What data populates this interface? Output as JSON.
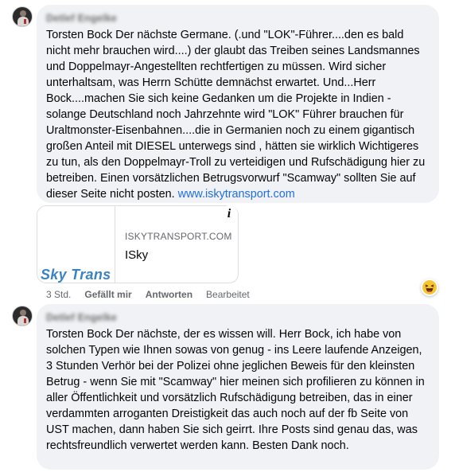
{
  "comments": [
    {
      "author": "Detlef Engelke",
      "text": "Torsten Bock Der nächste Germane. (.und \"LOK\"-Führer....den es bald nicht mehr brauchen wird....) der glaubt das Treiben seines Landsmannes und Doppelmayr-Angestellten rechtfertigen zu müssen. Wird sicher unterhaltsam, was Herrn Schütte demnächst erwartet. Und...Herr Bock....machen Sie sich keine Gedanken um die Projekte in Indien - solange Deutschland noch Jahrzehnte wird \"LOK\" Führer brauchen für Uraltmonster-Eisenbahnen....die in Germanien noch zu einem gigantisch großen Anteil mit DIESEL unterwegs sind , hätten sie wirklich Wichtigeres zu tun, als den Doppelmayr-Troll zu verteidigen und Rufschädigung hier zu betreiben. Einen vorsätzlichen Betrugsvorwurf \"Scamway\" sollten Sie auf dieser Seite nicht posten.",
      "link_text": "www.iskytransport.com"
    },
    {
      "author": "Detlef Engelke",
      "text": "Torsten Bock Der nächste, der es wissen will. Herr Bock, ich habe von solchen Typen wie Ihnen sowas von genug - ins Leere laufende Anzeigen, 3 Stunden Verhör bei der Polizei ohne jeglichen Beweis für den kleinsten Betrug - wenn Sie mit \"Scamway\" hier meinen sich profilieren zu können in aller Öffentlichkeit und vorsätzlich Rufschädigung betreiben, das in einer verdammten arroganten Dreistigkeit das auch noch auf der fb Seite von UST machen, dann haben Sie sich geirrt. Ihre Posts sind genau das, was rechtsfreundlich verwertet werden kann. Besten Dank noch."
    }
  ],
  "link_preview": {
    "thumb_text": "Sky Trans",
    "domain": "ISKYTRANSPORT.COM",
    "title": "ISky",
    "info_icon": "info-icon",
    "info_glyph": "i"
  },
  "actions": {
    "time": "3 Std.",
    "like": "Gefällt mir",
    "reply": "Antworten",
    "edited": "Bearbeitet"
  },
  "reaction": {
    "icon": "haha-reaction-icon"
  },
  "colors": {
    "bubble": "#f0f2f5",
    "link": "#216fdb",
    "meta": "#65676b",
    "thumb_logo": "#3b82c4"
  }
}
